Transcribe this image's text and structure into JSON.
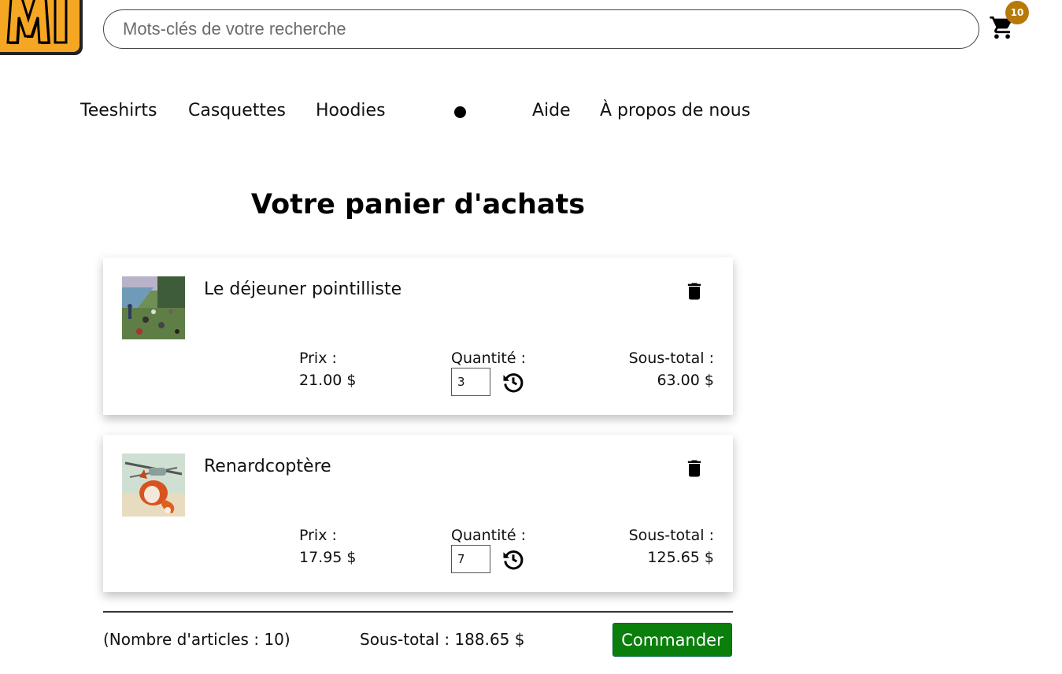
{
  "header": {
    "search_placeholder": "Mots-clés de votre recherche",
    "cart_count": "10"
  },
  "nav": {
    "items": [
      "Teeshirts",
      "Casquettes",
      "Hoodies",
      "Aide",
      "À propos de nous"
    ]
  },
  "cart": {
    "title": "Votre panier d'achats",
    "price_label": "Prix :",
    "qty_label": "Quantité :",
    "subtotal_label": "Sous-total :",
    "items": [
      {
        "name": "Le déjeuner pointilliste",
        "price": "21.00 $",
        "quantity": "3",
        "subtotal": "63.00 $"
      },
      {
        "name": "Renardcoptère",
        "price": "17.95 $",
        "quantity": "7",
        "subtotal": "125.65 $"
      }
    ]
  },
  "summary": {
    "count_text": "(Nombre d'articles : 10)",
    "total_text": "Sous-total : 188.65 $",
    "order_button": "Commander"
  },
  "colors": {
    "order_button": "#0b7f0b",
    "badge": "#b8790b",
    "logo": "#f5a623"
  },
  "icons": [
    "logo",
    "cart-icon",
    "trash-icon",
    "refresh-icon"
  ]
}
